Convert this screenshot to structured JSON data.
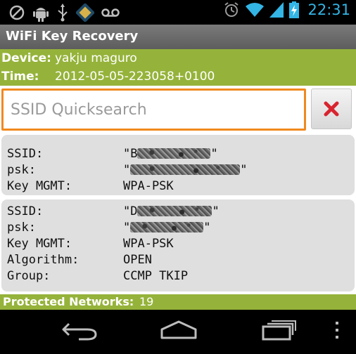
{
  "status_bar": {
    "left_icons": [
      "block-icon",
      "android-debug-icon",
      "usb-icon",
      "app-notification-icon",
      "voicemail-icon"
    ],
    "right_icons": [
      "alarm-icon",
      "wifi-icon",
      "signal-icon",
      "battery-charging-icon"
    ],
    "time": "22:31",
    "accent_color": "#33b5e5"
  },
  "app": {
    "title": "WiFi Key Recovery"
  },
  "info": {
    "device_label": "Device:",
    "device_value": "yakju maguro",
    "time_label": "Time:",
    "time_value": "2012-05-05-223058+0100"
  },
  "search": {
    "placeholder": "SSID Quicksearch",
    "value": "",
    "clear_icon": "close-icon",
    "border_color": "#f0891f"
  },
  "networks": [
    {
      "rows": [
        {
          "key": "SSID:",
          "value_prefix": "\"B",
          "value_suffix": "\""
        },
        {
          "key": "psk:",
          "value_prefix": "\"",
          "value_suffix": "\""
        },
        {
          "key": "Key MGMT:",
          "value": "WPA-PSK"
        }
      ]
    },
    {
      "rows": [
        {
          "key": "SSID:",
          "value_prefix": "\"D",
          "value_suffix": "\""
        },
        {
          "key": "psk:",
          "value_prefix": "\"",
          "value_suffix": "\""
        },
        {
          "key": "Key MGMT:",
          "value": "WPA-PSK"
        },
        {
          "key": "Algorithm:",
          "value": "OPEN"
        },
        {
          "key": "Group:",
          "value": "CCMP TKIP"
        }
      ]
    }
  ],
  "footer": {
    "label": "Protected Networks:",
    "count": "19",
    "color": "#95b33a"
  },
  "nav_bar": {
    "buttons": [
      "back-icon",
      "home-icon",
      "recent-apps-icon",
      "menu-icon"
    ]
  }
}
